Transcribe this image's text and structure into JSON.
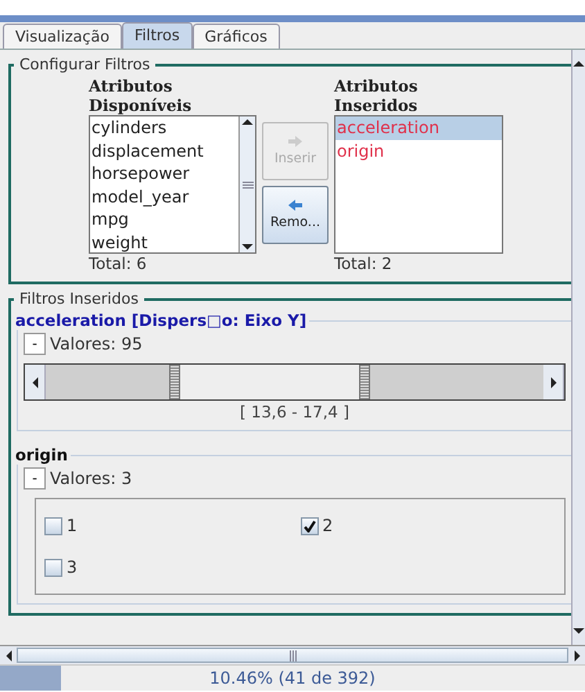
{
  "tabs": [
    {
      "label": "Visualização",
      "selected": false
    },
    {
      "label": "Filtros",
      "selected": true
    },
    {
      "label": "Gráficos",
      "selected": false
    }
  ],
  "config": {
    "title": "Configurar Filtros",
    "available": {
      "heading": "Atributos Disponíveis",
      "items": [
        {
          "label": "cylinders",
          "selected": false
        },
        {
          "label": "displacement",
          "selected": false
        },
        {
          "label": "horsepower",
          "selected": false
        },
        {
          "label": "model_year",
          "selected": false
        },
        {
          "label": "mpg",
          "selected": false
        },
        {
          "label": "weight",
          "selected": false
        }
      ],
      "total": "Total: 6"
    },
    "buttons": [
      {
        "kind": "insert",
        "label": "Inserir",
        "disabled": true
      },
      {
        "kind": "remove",
        "label": "Remo...",
        "disabled": false
      }
    ],
    "inserted": {
      "heading": "Atributos Inseridos",
      "items": [
        {
          "label": "acceleration",
          "selected": true
        },
        {
          "label": "origin",
          "selected": false
        }
      ],
      "total": "Total: 2"
    }
  },
  "filters": {
    "title": "Filtros Inseridos",
    "items": [
      {
        "kind": "range",
        "title": "acceleration [Dispers□o: Eixo Y]",
        "toggle": "-",
        "count": "Valores: 95",
        "thumbs": [
          {
            "level": 0.26
          },
          {
            "level": 0.64
          }
        ],
        "range": "[ 13,6 - 17,4 ]"
      },
      {
        "kind": "values",
        "title": "origin",
        "toggle": "-",
        "count": "Valores: 3",
        "values": [
          {
            "label": "1",
            "checked": false
          },
          {
            "label": "2",
            "checked": true
          },
          {
            "label": "3",
            "checked": false
          }
        ]
      }
    ]
  },
  "status": {
    "level": 0.1046,
    "text": "10.46% (41 de 392)"
  }
}
